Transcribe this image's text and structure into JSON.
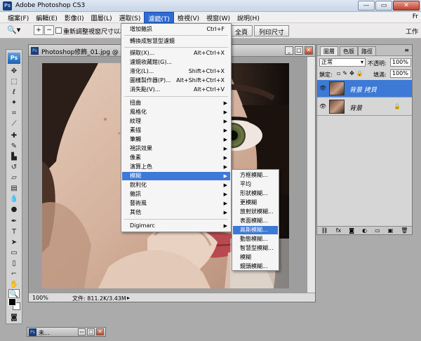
{
  "app": {
    "title": "Adobe Photoshop CS3",
    "badge": "Ps",
    "window_buttons": [
      "—",
      "▭",
      "✕"
    ]
  },
  "menubar": {
    "items": [
      "檔案(F)",
      "編輯(E)",
      "影像(I)",
      "圖層(L)",
      "選取(S)",
      "濾鏡(T)",
      "檢視(V)",
      "視窗(W)",
      "說明(H)"
    ],
    "active_index": 5,
    "right_label": "Fr"
  },
  "options": {
    "resize_label": "重新調整視窗尺寸以相合",
    "full_label": "全頁",
    "print_label": "列印尺寸",
    "workspace_label": "工作"
  },
  "toolbox": {
    "logo": "Ps",
    "tools": [
      "move-icon",
      "marquee-icon",
      "lasso-icon",
      "magic-wand-icon",
      "crop-icon",
      "slice-icon",
      "healing-icon",
      "brush-icon",
      "stamp-icon",
      "history-brush-icon",
      "eraser-icon",
      "gradient-icon",
      "blur-icon",
      "dodge-icon",
      "pen-icon",
      "type-icon",
      "path-select-icon",
      "shape-icon",
      "notes-icon",
      "eyedropper-icon",
      "hand-icon",
      "zoom-icon"
    ]
  },
  "document": {
    "title": "Photoshop修飾_01.jpg @ 100%",
    "zoom": "100%",
    "file_size": "文件: 811.2K/3.43M"
  },
  "filter_menu": {
    "groups": [
      [
        {
          "label": "增加雜訊",
          "shortcut": "Ctrl+F",
          "submenu": false
        }
      ],
      [
        {
          "label": "轉換成智慧型濾鏡",
          "shortcut": "",
          "submenu": false
        }
      ],
      [
        {
          "label": "擷取(X)...",
          "shortcut": "Alt+Ctrl+X",
          "submenu": false
        },
        {
          "label": "濾鏡收藏館(G)...",
          "shortcut": "",
          "submenu": false
        },
        {
          "label": "液化(L)...",
          "shortcut": "Shift+Ctrl+X",
          "submenu": false
        },
        {
          "label": "圖樣製作器(P)...",
          "shortcut": "Alt+Shift+Ctrl+X",
          "submenu": false
        },
        {
          "label": "消失點(V)...",
          "shortcut": "Alt+Ctrl+V",
          "submenu": false
        }
      ],
      [
        {
          "label": "扭曲",
          "shortcut": "",
          "submenu": true
        },
        {
          "label": "風格化",
          "shortcut": "",
          "submenu": true
        },
        {
          "label": "紋理",
          "shortcut": "",
          "submenu": true
        },
        {
          "label": "素描",
          "shortcut": "",
          "submenu": true
        },
        {
          "label": "筆觸",
          "shortcut": "",
          "submenu": true
        },
        {
          "label": "視訊效果",
          "shortcut": "",
          "submenu": true
        },
        {
          "label": "像素",
          "shortcut": "",
          "submenu": true
        },
        {
          "label": "演算上色",
          "shortcut": "",
          "submenu": true
        },
        {
          "label": "模糊",
          "shortcut": "",
          "submenu": true
        },
        {
          "label": "銳利化",
          "shortcut": "",
          "submenu": true
        },
        {
          "label": "雜訊",
          "shortcut": "",
          "submenu": true
        },
        {
          "label": "藝術風",
          "shortcut": "",
          "submenu": true
        },
        {
          "label": "其他",
          "shortcut": "",
          "submenu": true
        }
      ],
      [
        {
          "label": "Digimarc",
          "shortcut": "",
          "submenu": true
        }
      ]
    ],
    "highlighted": "模糊"
  },
  "blur_submenu": {
    "items": [
      "方框模糊...",
      "平均",
      "形狀模糊...",
      "更模糊",
      "放射狀模糊...",
      "表面模糊...",
      "高斯模糊...",
      "動態模糊...",
      "智慧型模糊...",
      "模糊",
      "鏡頭模糊..."
    ],
    "highlighted": "高斯模糊..."
  },
  "layers_panel": {
    "tabs": [
      "圖層",
      "色版",
      "路徑"
    ],
    "blend_mode": "正常",
    "opacity_label": "不透明:",
    "opacity_value": "100%",
    "lock_label": "鎖定:",
    "fill_label": "填滿:",
    "fill_value": "100%",
    "layers": [
      {
        "name": "背景 拷貝",
        "selected": true,
        "locked": false
      },
      {
        "name": "背景",
        "selected": false,
        "locked": true
      }
    ],
    "footer_icons": [
      "link-icon",
      "fx-icon",
      "mask-icon",
      "adjustment-icon",
      "group-icon",
      "new-layer-icon",
      "trash-icon"
    ]
  },
  "minimized_doc": {
    "title": "未..."
  }
}
